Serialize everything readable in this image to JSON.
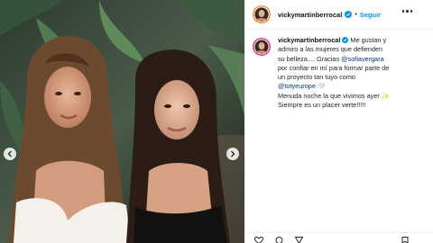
{
  "post": {
    "username": "vickymartinberrocal",
    "follow_label": "Seguir",
    "separator": "•",
    "caption": {
      "line1": "Me gustan y",
      "line2": "admiro a las mujeres que defienden",
      "line3": "su belleza.... Gracias",
      "mention1": "@sofiavergara",
      "line4": "por confiar en mí para formar parte de",
      "line5": "un proyecto tan tuyo como",
      "mention2": "@totyeurope",
      "line6_emoji": "🤍",
      "line7": "Menuda noche la que vivimos ayer",
      "line7_emoji": "✨",
      "line8": "Siempre es un placer verte!!!!!"
    }
  },
  "colors": {
    "accent": "#0095f6",
    "mention": "#00376b",
    "text": "#262626",
    "border": "#efefef"
  },
  "icons": [
    "verified-icon",
    "more-options-icon",
    "chevron-left-icon",
    "chevron-right-icon",
    "heart-icon",
    "comment-icon",
    "share-icon",
    "bookmark-icon"
  ]
}
